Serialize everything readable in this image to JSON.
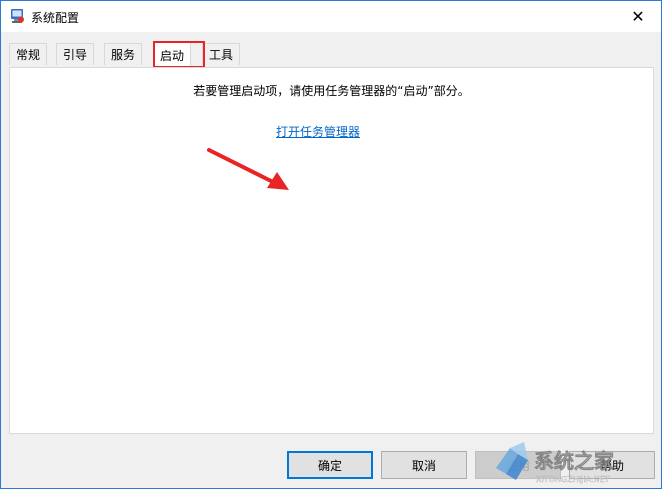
{
  "window": {
    "title": "系统配置"
  },
  "tabs": [
    {
      "label": "常规"
    },
    {
      "label": "引导"
    },
    {
      "label": "服务"
    },
    {
      "label": "启动",
      "active": true
    },
    {
      "label": "工具"
    }
  ],
  "startup_panel": {
    "message": "若要管理启动项，请使用任务管理器的“启动”部分。",
    "link": "打开任务管理器"
  },
  "buttons": {
    "ok": "确定",
    "cancel": "取消",
    "apply": "应用",
    "help": "帮助"
  },
  "colors": {
    "accent": "#0078d7",
    "link": "#0066cc",
    "annotation": "#e82424"
  },
  "watermark": {
    "text": "系统之家",
    "url_text": "XITONGZHIJIA.NET"
  }
}
